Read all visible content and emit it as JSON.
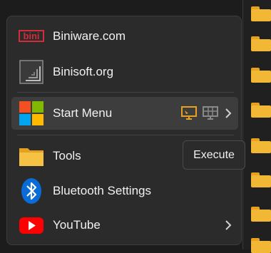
{
  "menu": {
    "items": [
      {
        "label": "Biniware.com",
        "icon": "biniware-logo-icon"
      },
      {
        "label": "Binisoft.org",
        "icon": "binisoft-logo-icon"
      },
      {
        "label": "Start Menu",
        "icon": "windows-logo-icon",
        "actions": [
          "execute-icon",
          "grid-icon"
        ],
        "submenu": true
      },
      {
        "label": "Tools",
        "icon": "folder-icon"
      },
      {
        "label": "Bluetooth Settings",
        "icon": "bluetooth-icon"
      },
      {
        "label": "YouTube",
        "icon": "youtube-icon",
        "submenu": true
      }
    ]
  },
  "tooltip": {
    "text": "Execute"
  },
  "colors": {
    "menu_bg": "#2b2b2b",
    "hover_bg": "#3d3d3d",
    "text": "#f1f1f1",
    "accent_orange": "#e5a11f",
    "bluetooth_blue": "#0a6cd6",
    "youtube_red": "#ff0000"
  }
}
